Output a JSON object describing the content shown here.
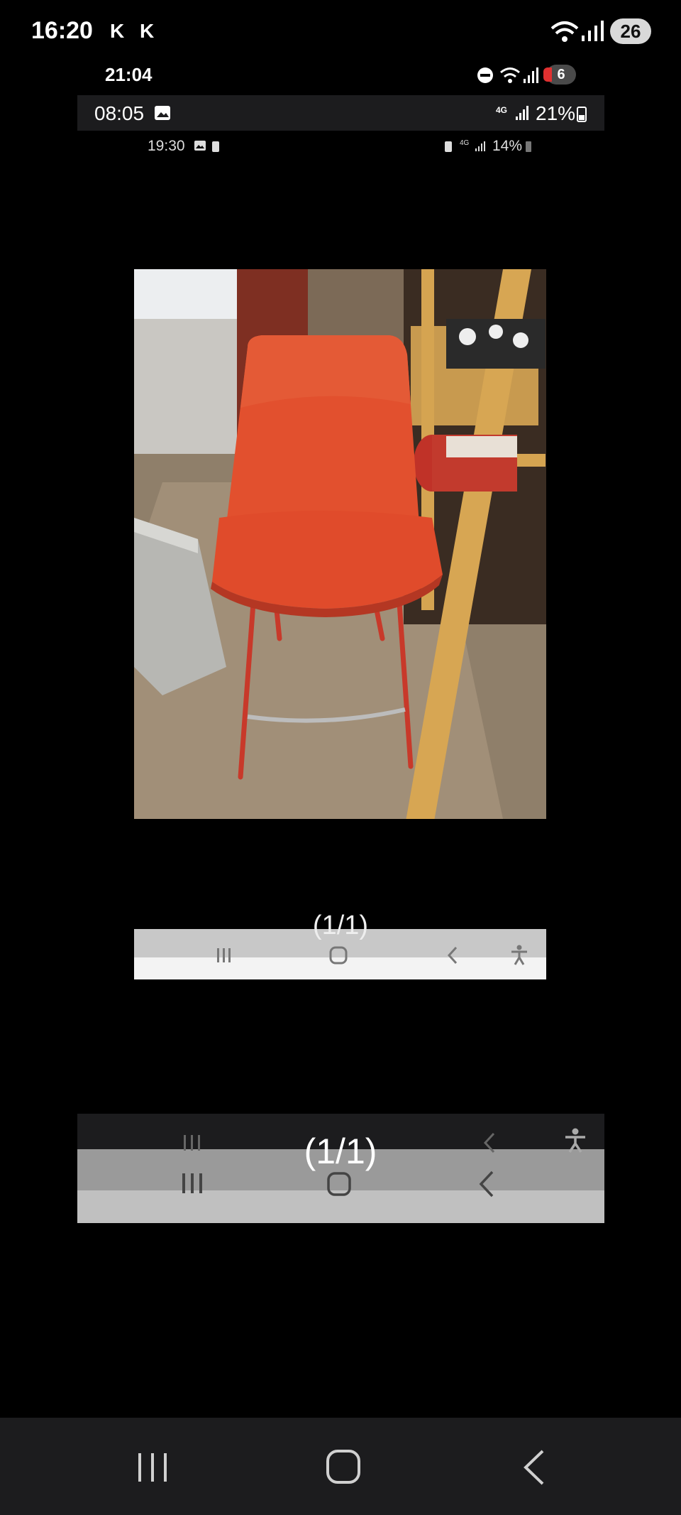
{
  "status_bars": [
    {
      "time": "16:20",
      "extra_glyphs": [
        "K",
        "K"
      ],
      "notification_count": "26"
    },
    {
      "time": "21:04",
      "notification_count": "6"
    },
    {
      "time": "08:05",
      "network": "4G",
      "battery": "21%"
    },
    {
      "time": "19:30",
      "network": "4G",
      "battery": "14%"
    }
  ],
  "viewer": {
    "image_description_icon": "photo-of-orange-bar-stool",
    "counter_small": "(1/1)",
    "counter_large": "(1/1)"
  },
  "nav": {
    "recents": "recents-icon",
    "home": "home-icon",
    "back": "back-icon",
    "accessibility": "accessibility-icon"
  },
  "colors": {
    "stool": "#e2502e",
    "status_bar_dark": "#1c1c1e"
  }
}
